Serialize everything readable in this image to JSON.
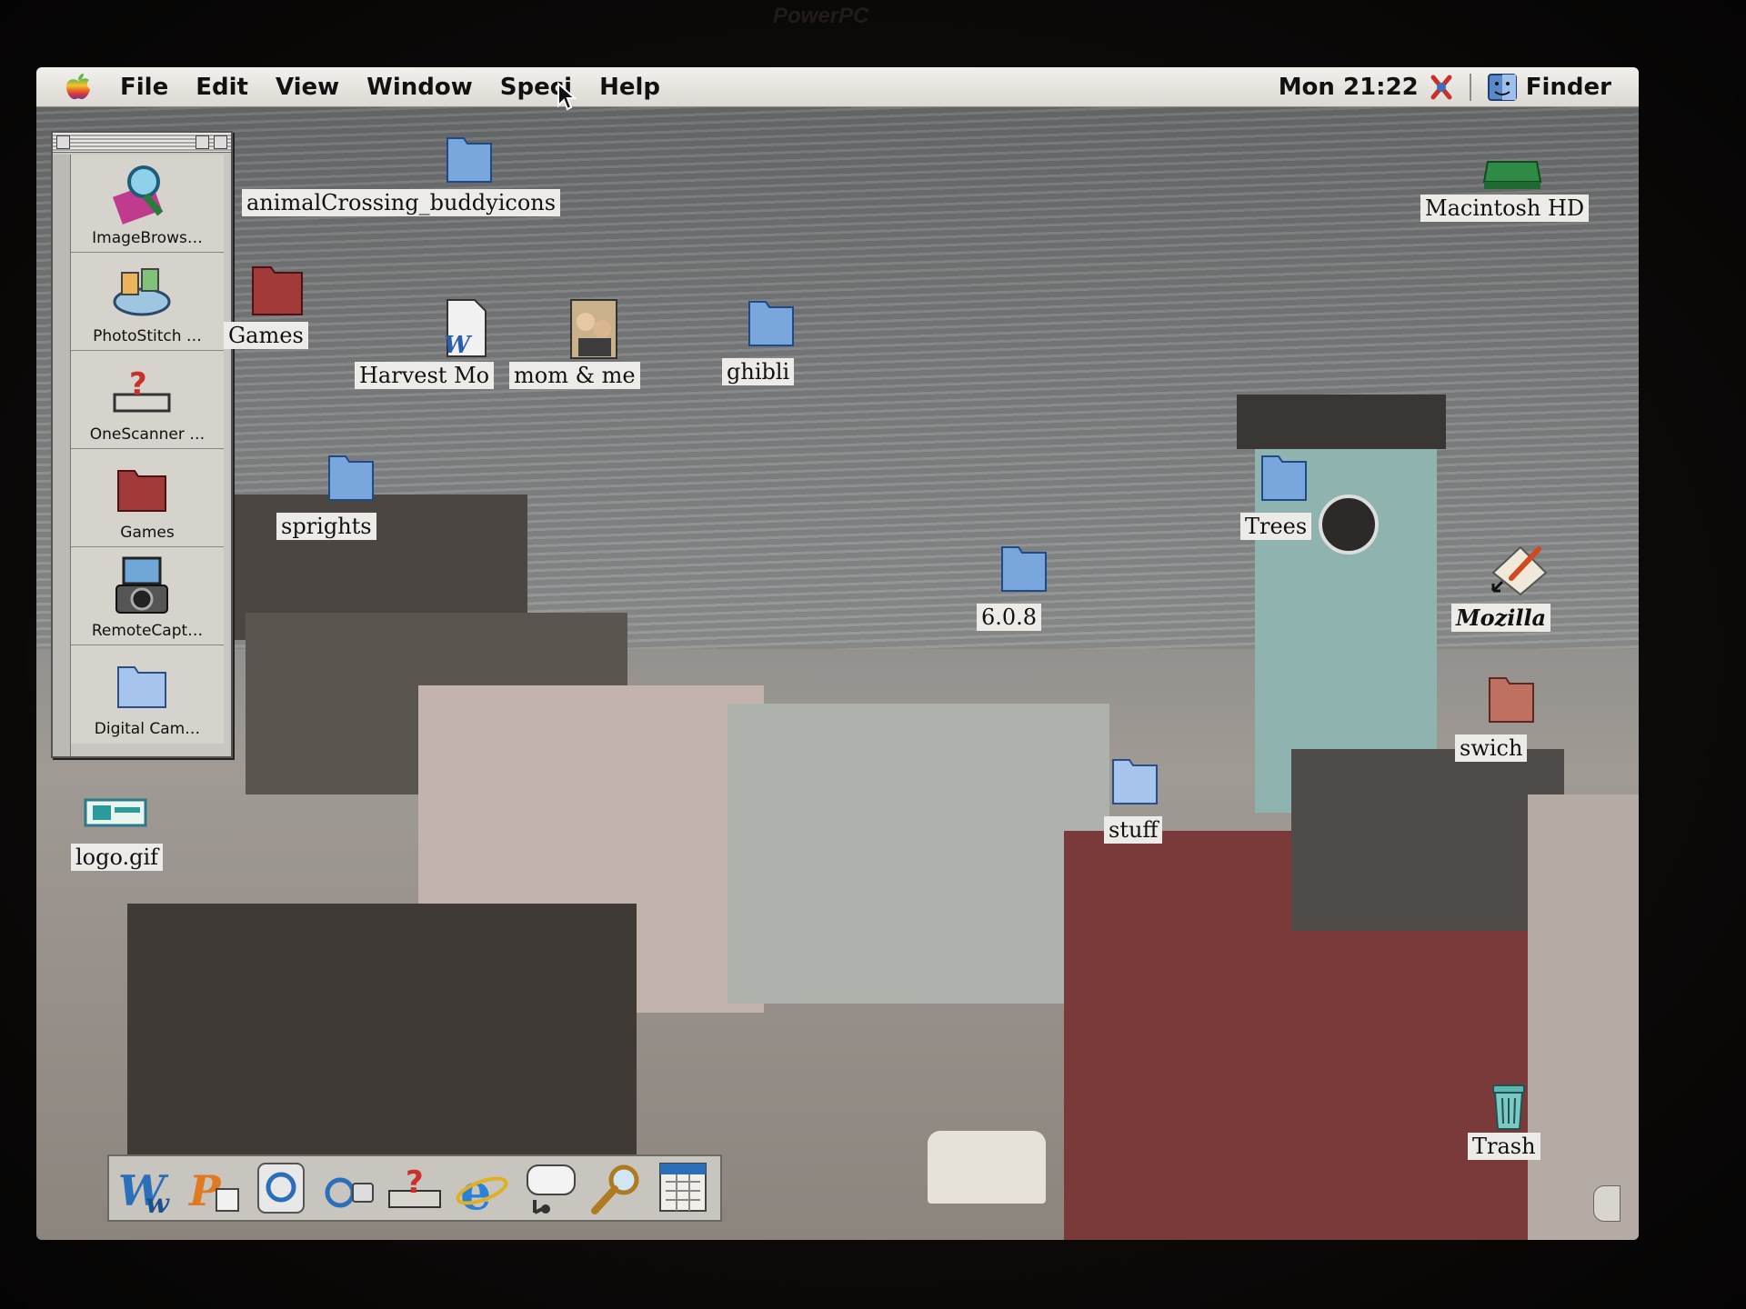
{
  "monitor": {
    "brand": "PowerPC"
  },
  "menubar": {
    "apple_menu_icon": "apple-icon",
    "items": [
      "File",
      "Edit",
      "View",
      "Window",
      "Speci",
      "Help"
    ],
    "clock": "Mon 21:22",
    "active_app": "Finder"
  },
  "launcher": {
    "items": [
      {
        "label": "ImageBrows…",
        "icon": "image-browser-icon"
      },
      {
        "label": "PhotoStitch …",
        "icon": "photostitch-icon"
      },
      {
        "label": "OneScanner …",
        "icon": "onescanner-icon"
      },
      {
        "label": "Games",
        "icon": "games-folder-icon"
      },
      {
        "label": "RemoteCapt…",
        "icon": "remote-capture-icon"
      },
      {
        "label": "Digital Cam…",
        "icon": "folder-icon"
      }
    ]
  },
  "desktop": {
    "icons": [
      {
        "label": "animalCrossing_buddyicons",
        "type": "folder"
      },
      {
        "label": "Games",
        "type": "folder"
      },
      {
        "label": "Harvest Mo",
        "type": "document"
      },
      {
        "label": "mom & me",
        "type": "image"
      },
      {
        "label": "ghibli",
        "type": "folder"
      },
      {
        "label": "sprights",
        "type": "folder"
      },
      {
        "label": "Trees",
        "type": "folder"
      },
      {
        "label": "6.0.8",
        "type": "folder"
      },
      {
        "label": "Macintosh HD",
        "type": "hard-disk"
      },
      {
        "label": "Mozilla",
        "type": "alias"
      },
      {
        "label": "swich",
        "type": "folder"
      },
      {
        "label": "stuff",
        "type": "folder"
      },
      {
        "label": "logo.gif",
        "type": "image"
      },
      {
        "label": "Trash",
        "type": "trash"
      }
    ]
  },
  "control_strip": {
    "buttons": [
      "word-icon",
      "powerpoint-icon",
      "quicktime-icon",
      "camera-icon",
      "help-icon",
      "internet-explorer-icon",
      "speech-icon",
      "sherlock-icon",
      "calendar-icon"
    ]
  },
  "colors": {
    "folder_blue": "#7aa6de",
    "games_folder_red": "#a23a3a",
    "swich_folder": "#c07060",
    "menubar": "#e6e3de",
    "label_bg": "#ecebe7"
  }
}
